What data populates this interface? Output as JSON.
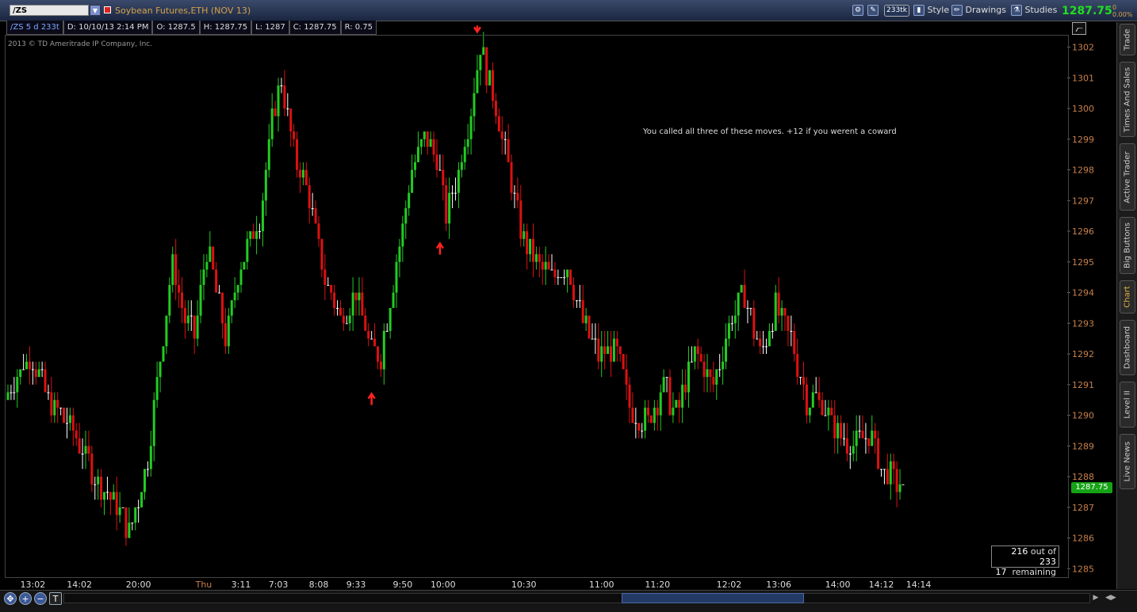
{
  "header": {
    "symbol": "/ZS",
    "instrument": "Soybean Futures,ETH (NOV 13)",
    "tick_badge": "233tk",
    "style_label": "Style",
    "drawings_label": "Drawings",
    "studies_label": "Studies",
    "last_price": "1287.75",
    "change_top": "0",
    "change_pct": "0.00%"
  },
  "infobar": {
    "symbol_agg": "/ZS 5 d 233t",
    "date": "D: 10/10/13 2:14 PM",
    "open": "O: 1287.5",
    "high": "H: 1287.75",
    "low": "L: 1287",
    "close": "C: 1287.75",
    "range": "R: 0.75"
  },
  "copyright": "2013 © TD Ameritrade IP Company, Inc.",
  "annotation": "You called all three of these moves.  +12 if you werent a coward",
  "remaining": {
    "count": "216",
    "out_of_text": "out of",
    "total": "233",
    "left": "17",
    "left_text": "remaining"
  },
  "price_tag": "1287.75",
  "sidebar_tabs": [
    "Trade",
    "Times And Sales",
    "Active Trader",
    "Big Buttons",
    "Chart",
    "Dashboard",
    "Level II",
    "Live News"
  ],
  "sidebar_active": "Chart",
  "colors": {
    "up": "#22cc22",
    "down": "#dd1111",
    "neutral": "#ffffff",
    "price_axis": "#c8804a",
    "time_axis": "#c8804a",
    "arrow": "#ff2222"
  },
  "chart_data": {
    "type": "candlestick",
    "ylim": [
      1284.75,
      1302.35
    ],
    "y_ticks": [
      1285,
      1286,
      1287,
      1288,
      1289,
      1290,
      1291,
      1292,
      1293,
      1294,
      1295,
      1296,
      1297,
      1298,
      1299,
      1300,
      1301,
      1302
    ],
    "x_tick_labels": [
      {
        "label": "13:02",
        "bar": 8
      },
      {
        "label": "14:02",
        "bar": 23
      },
      {
        "label": "20:00",
        "bar": 42
      },
      {
        "label": "Thu",
        "bar": 63
      },
      {
        "label": "3:11",
        "bar": 75
      },
      {
        "label": "7:03",
        "bar": 87
      },
      {
        "label": "8:08",
        "bar": 100
      },
      {
        "label": "9:33",
        "bar": 112
      },
      {
        "label": "9:50",
        "bar": 127
      },
      {
        "label": "10:00",
        "bar": 140
      },
      {
        "label": "10:30",
        "bar": 166
      },
      {
        "label": "11:00",
        "bar": 191
      },
      {
        "label": "11:20",
        "bar": 209
      },
      {
        "label": "12:02",
        "bar": 232
      },
      {
        "label": "13:06",
        "bar": 248
      },
      {
        "label": "14:00",
        "bar": 267
      },
      {
        "label": "14:12",
        "bar": 281
      },
      {
        "label": "14:14",
        "bar": 293
      }
    ],
    "highlight_labels": [
      "Thu"
    ],
    "num_bars": 289,
    "anchors": [
      [
        0,
        1290.5
      ],
      [
        8,
        1292
      ],
      [
        14,
        1290.5
      ],
      [
        22,
        1289.5
      ],
      [
        28,
        1288.2
      ],
      [
        36,
        1287.0
      ],
      [
        40,
        1286.2
      ],
      [
        46,
        1288.5
      ],
      [
        50,
        1292.0
      ],
      [
        54,
        1295.0
      ],
      [
        58,
        1293.2
      ],
      [
        61,
        1292.5
      ],
      [
        65,
        1295.5
      ],
      [
        71,
        1292.5
      ],
      [
        76,
        1295.0
      ],
      [
        82,
        1296.5
      ],
      [
        86,
        1299.5
      ],
      [
        89,
        1301.0
      ],
      [
        93,
        1298.5
      ],
      [
        97,
        1297.5
      ],
      [
        103,
        1294.5
      ],
      [
        108,
        1293.2
      ],
      [
        113,
        1294.0
      ],
      [
        118,
        1292.0
      ],
      [
        121,
        1292.0
      ],
      [
        126,
        1295.0
      ],
      [
        131,
        1298.0
      ],
      [
        135,
        1299.0
      ],
      [
        139,
        1298.5
      ],
      [
        142,
        1296.5
      ],
      [
        146,
        1298.0
      ],
      [
        150,
        1300.0
      ],
      [
        153,
        1302.0
      ],
      [
        157,
        1300.5
      ],
      [
        162,
        1298.0
      ],
      [
        166,
        1296.0
      ],
      [
        171,
        1295.0
      ],
      [
        176,
        1294.5
      ],
      [
        181,
        1295.0
      ],
      [
        186,
        1293.0
      ],
      [
        191,
        1292.0
      ],
      [
        197,
        1292.0
      ],
      [
        202,
        1290.0
      ],
      [
        207,
        1289.8
      ],
      [
        212,
        1291.0
      ],
      [
        216,
        1290.0
      ],
      [
        222,
        1292.0
      ],
      [
        228,
        1291.0
      ],
      [
        233,
        1293.0
      ],
      [
        238,
        1294.0
      ],
      [
        243,
        1292.0
      ],
      [
        248,
        1293.5
      ],
      [
        253,
        1292.5
      ],
      [
        258,
        1290.5
      ],
      [
        263,
        1290.5
      ],
      [
        267,
        1289.5
      ],
      [
        273,
        1289.0
      ],
      [
        278,
        1289.5
      ],
      [
        282,
        1288.2
      ],
      [
        288,
        1287.75
      ]
    ],
    "markers": [
      {
        "type": "arrow-up",
        "bar": 117,
        "price": 1290.7
      },
      {
        "type": "arrow-up",
        "bar": 139,
        "price": 1295.6
      },
      {
        "type": "arrow-down",
        "bar": 151,
        "price": 1302.5
      }
    ]
  }
}
